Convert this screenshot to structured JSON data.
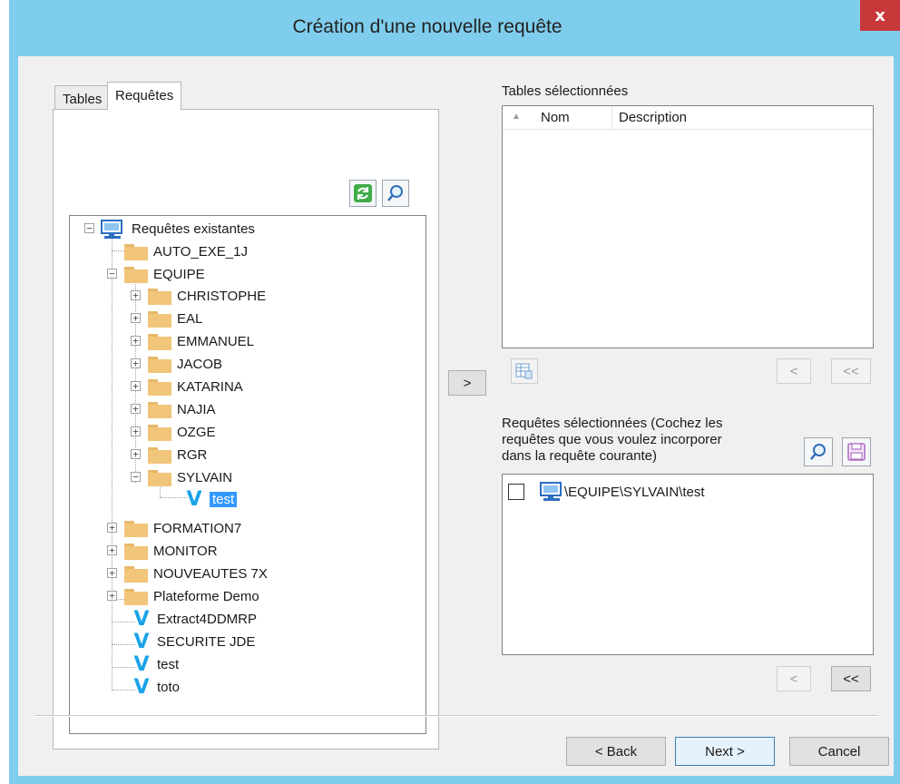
{
  "window": {
    "title": "Création d'une nouvelle requête",
    "close_label": "x"
  },
  "tabs": [
    {
      "label": "Tables",
      "active": false
    },
    {
      "label": "Requêtes",
      "active": true
    }
  ],
  "toolbar": {
    "refresh_icon": "refresh-icon",
    "search_icon": "search-icon"
  },
  "tree": {
    "root": {
      "label": "Requêtes existantes",
      "icon": "computer-icon"
    },
    "items": [
      {
        "label": "AUTO_EXE_1J",
        "type": "folder"
      },
      {
        "label": "EQUIPE",
        "type": "folder",
        "expanded": true
      },
      {
        "label": "CHRISTOPHE",
        "type": "folder"
      },
      {
        "label": "EAL",
        "type": "folder"
      },
      {
        "label": "EMMANUEL",
        "type": "folder"
      },
      {
        "label": "JACOB",
        "type": "folder"
      },
      {
        "label": "KATARINA",
        "type": "folder"
      },
      {
        "label": "NAJIA",
        "type": "folder"
      },
      {
        "label": "OZGE",
        "type": "folder"
      },
      {
        "label": "RGR",
        "type": "folder"
      },
      {
        "label": "SYLVAIN",
        "type": "folder",
        "expanded": true
      },
      {
        "label": "test",
        "type": "query",
        "selected": true
      },
      {
        "label": "FORMATION7",
        "type": "folder"
      },
      {
        "label": "MONITOR",
        "type": "folder"
      },
      {
        "label": "NOUVEAUTES 7X",
        "type": "folder"
      },
      {
        "label": "Plateforme Demo",
        "type": "folder"
      },
      {
        "label": "Extract4DDMRP",
        "type": "query"
      },
      {
        "label": "SECURITE JDE",
        "type": "query"
      },
      {
        "label": "test",
        "type": "query"
      },
      {
        "label": "toto",
        "type": "query"
      }
    ]
  },
  "add_button_label": ">",
  "tables_section": {
    "label": "Tables sélectionnées",
    "columns": [
      "Nom",
      "Description"
    ],
    "sort_glyph": "▲",
    "remove_label": "<",
    "remove_all_label": "<<"
  },
  "queries_section": {
    "label_lines": [
      "Requêtes sélectionnées (Cochez les",
      "requêtes que vous voulez incorporer",
      "dans la requête courante)"
    ],
    "items": [
      {
        "label": "\\EQUIPE\\SYLVAIN\\test",
        "checked": false
      }
    ],
    "remove_label": "<",
    "remove_all_label": "<<"
  },
  "footer": {
    "back_label": "< Back",
    "next_label": "Next >",
    "cancel_label": "Cancel"
  },
  "colors": {
    "window_frame": "#7fcdec",
    "close_button": "#c7383a",
    "selection": "#3399ff",
    "folder": "#f1c57a",
    "query_icon": "#1aa3e8"
  }
}
